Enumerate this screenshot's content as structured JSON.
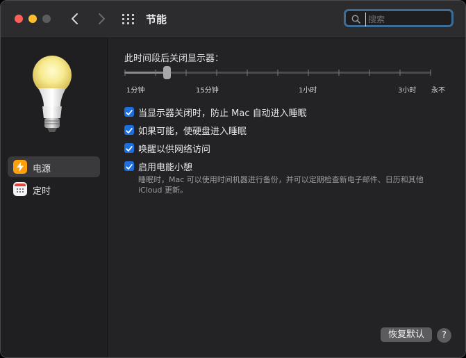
{
  "window": {
    "title": "节能"
  },
  "search": {
    "placeholder": "搜索",
    "value": ""
  },
  "sidebar": {
    "items": [
      {
        "label": "电源",
        "icon": "lightning-bolt-icon",
        "selected": true
      },
      {
        "label": "定时",
        "icon": "calendar-icon",
        "selected": false
      }
    ]
  },
  "display_sleep": {
    "label": "此时间段后关闭显示器：",
    "ticks": [
      "1分钟",
      "15分钟",
      "1小时",
      "3小时",
      "永不"
    ],
    "value": "15分钟"
  },
  "options": [
    {
      "label": "当显示器关闭时，防止 Mac 自动进入睡眠",
      "checked": true
    },
    {
      "label": "如果可能，使硬盘进入睡眠",
      "checked": true
    },
    {
      "label": "唤醒以供网络访问",
      "checked": true
    },
    {
      "label": "启用电能小憩",
      "checked": true
    }
  ],
  "power_nap_note": "睡眠时，Mac 可以使用时间机器进行备份，并可以定期检查新电子邮件、日历和其他 iCloud 更新。",
  "footer": {
    "restore_label": "恢复默认",
    "help_label": "?"
  },
  "colors": {
    "accent": "#1d6fe0",
    "search_focus": "#3d6e9a",
    "power_icon": "#ff9f0a"
  }
}
